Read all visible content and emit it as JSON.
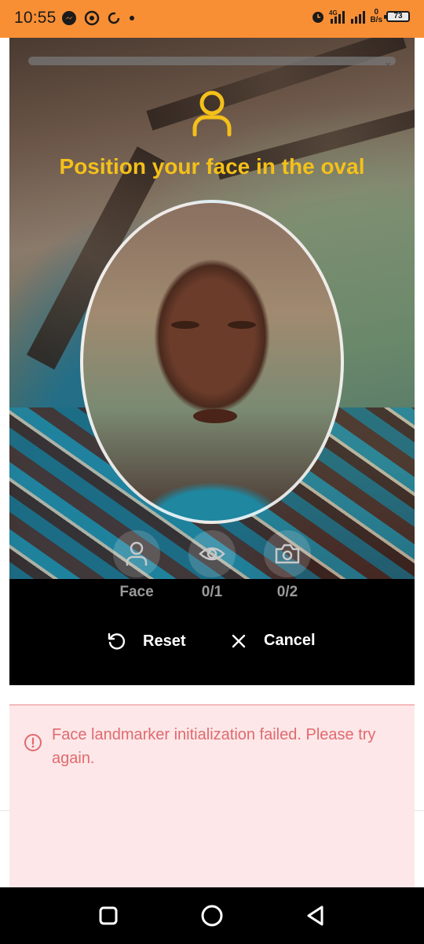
{
  "status_bar": {
    "time": "10:55",
    "left_icons": [
      "messenger-icon",
      "browser-icon",
      "sync-icon",
      "dot-icon"
    ],
    "network_speed_value": "0",
    "network_speed_unit": "B/s",
    "network_type": "4G",
    "battery_level": "73"
  },
  "camera": {
    "instruction": "Position your face in the oval",
    "accent_color": "#f4c01a"
  },
  "steps": [
    {
      "icon": "person-icon",
      "label": "Face"
    },
    {
      "icon": "eye-icon",
      "label": "0/1"
    },
    {
      "icon": "camera-icon",
      "label": "0/2"
    }
  ],
  "actions": {
    "reset_label": "Reset",
    "cancel_label": "Cancel"
  },
  "alert": {
    "message": "Face landmarker initialization failed. Please try again.",
    "color": "#e06a6f",
    "background": "#fde7e8"
  },
  "nav_bar": {
    "buttons": [
      "recents-icon",
      "home-icon",
      "back-icon"
    ]
  }
}
